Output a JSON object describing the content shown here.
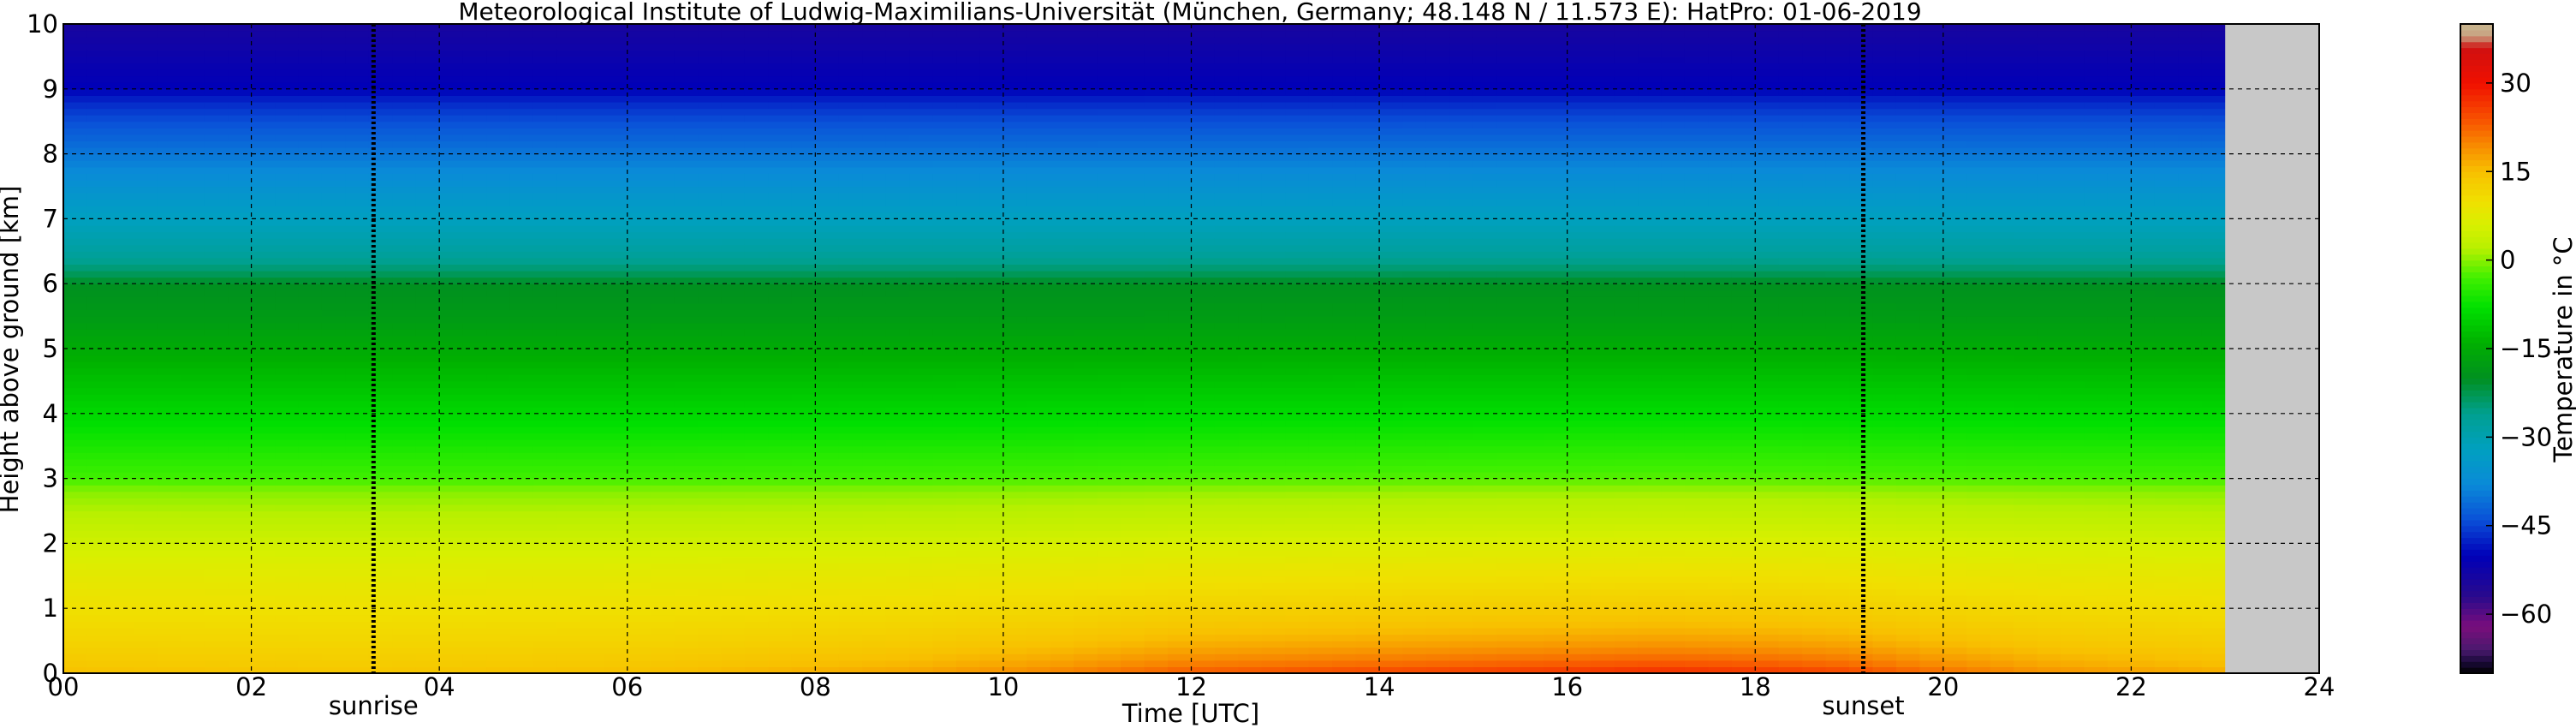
{
  "chart_data": {
    "type": "heatmap",
    "title": "Meteorological Institute of Ludwig-Maximilians-Universität (München, Germany; 48.148 N / 11.573 E):    HatPro: 01-06-2019",
    "xlabel": "Time [UTC]",
    "ylabel": "Height above ground [km]",
    "xlim": [
      0,
      24
    ],
    "ylim": [
      0,
      10
    ],
    "x_ticks": [
      "00",
      "02",
      "04",
      "06",
      "08",
      "10",
      "12",
      "14",
      "16",
      "18",
      "20",
      "22",
      "24"
    ],
    "y_ticks": [
      "0",
      "1",
      "2",
      "3",
      "4",
      "5",
      "6",
      "7",
      "8",
      "9",
      "10"
    ],
    "grid": true,
    "data_end_hour": 23.0,
    "no_data_color": "#c8c8c8",
    "annotations": [
      {
        "label": "sunrise",
        "x": 3.3
      },
      {
        "label": "sunset",
        "x": 19.15
      }
    ],
    "colorbar": {
      "label": "Temperature in °C",
      "min": -70,
      "max": 40,
      "ticks": [
        "30",
        "15",
        "0",
        "−15",
        "−30",
        "−45",
        "−60"
      ],
      "stops": [
        {
          "v": -70,
          "c": "#000000"
        },
        {
          "v": -68,
          "c": "#1a0a3a"
        },
        {
          "v": -66,
          "c": "#4a1a6e"
        },
        {
          "v": -62,
          "c": "#7a0d7c"
        },
        {
          "v": -57,
          "c": "#2a0a8c"
        },
        {
          "v": -50,
          "c": "#0000b8"
        },
        {
          "v": -44,
          "c": "#0a50d8"
        },
        {
          "v": -38,
          "c": "#0a8ad8"
        },
        {
          "v": -32,
          "c": "#00a0c0"
        },
        {
          "v": -26,
          "c": "#00a090"
        },
        {
          "v": -20,
          "c": "#009020"
        },
        {
          "v": -14,
          "c": "#00b000"
        },
        {
          "v": -8,
          "c": "#00e000"
        },
        {
          "v": -3,
          "c": "#40f000"
        },
        {
          "v": 2,
          "c": "#b8f000"
        },
        {
          "v": 6,
          "c": "#d8f000"
        },
        {
          "v": 10,
          "c": "#f0e000"
        },
        {
          "v": 15,
          "c": "#f8c000"
        },
        {
          "v": 19,
          "c": "#f89000"
        },
        {
          "v": 24,
          "c": "#f85000"
        },
        {
          "v": 30,
          "c": "#f01000"
        },
        {
          "v": 36,
          "c": "#d01010"
        },
        {
          "v": 38,
          "c": "#c8a080"
        },
        {
          "v": 40,
          "c": "#c8b890"
        }
      ]
    },
    "profile": {
      "heights_km": [
        0,
        0.1,
        0.5,
        1,
        1.5,
        2,
        2.3,
        2.8,
        3,
        3.5,
        4,
        4.5,
        5,
        5.5,
        6,
        6.2,
        6.5,
        7,
        7.5,
        8,
        8.5,
        8.8,
        9,
        9.5,
        10
      ],
      "temps_c": [
        15,
        14,
        12,
        10,
        8,
        5,
        3,
        0,
        -3,
        -6,
        -9,
        -12,
        -15,
        -18,
        -20,
        -24,
        -28,
        -32,
        -36,
        -40,
        -44,
        -47,
        -50,
        -52,
        -54
      ]
    },
    "diurnal_near_surface": {
      "hours": [
        0,
        3,
        6,
        9,
        10.5,
        12,
        14,
        16,
        17,
        18,
        19,
        20,
        21,
        23
      ],
      "delta_c": [
        0,
        -1,
        0,
        3,
        6,
        10,
        12,
        14,
        15,
        14,
        12,
        8,
        5,
        2
      ]
    }
  }
}
